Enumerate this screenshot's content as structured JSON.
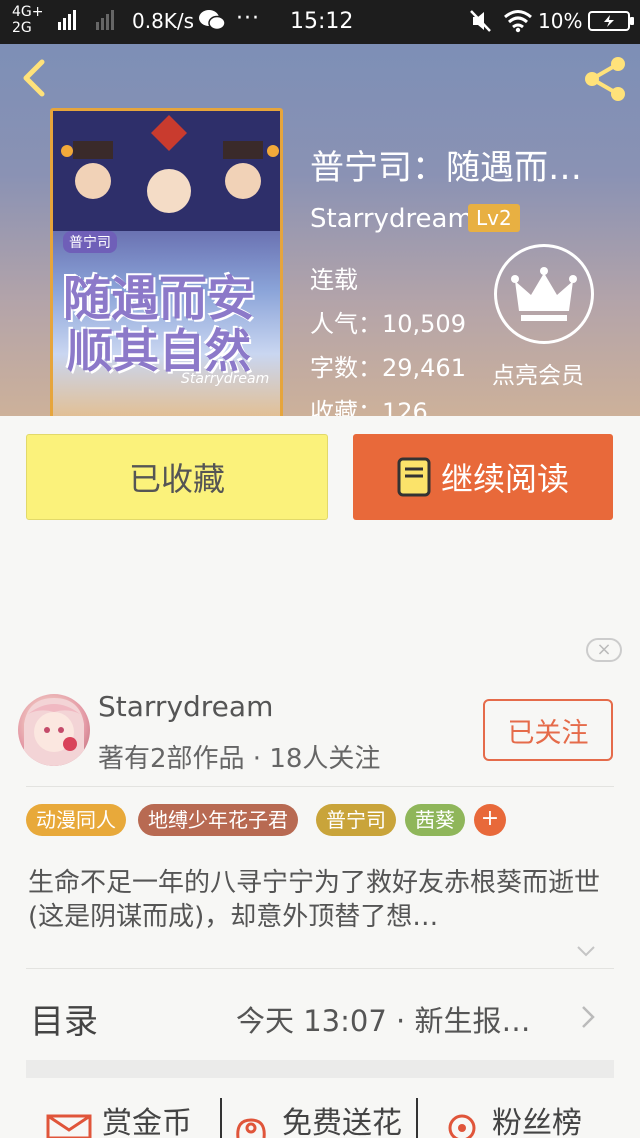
{
  "status_bar": {
    "network_top": "4G+",
    "network_bottom": "2G",
    "speed": "0.8K/s",
    "dots": "···",
    "time": "15:12",
    "battery": "10%"
  },
  "header": {
    "back_icon": "chevron-left-icon",
    "share_icon": "share-icon"
  },
  "cover": {
    "tag": "普宁司",
    "line1": "随遇而安",
    "line2": "顺其自然",
    "signature": "Starrydream"
  },
  "book": {
    "title": "普宁司：随遇而…",
    "author": "Starrydream",
    "level": "Lv2",
    "status": "连载",
    "popularity": "人气：10,509",
    "word_count": "字数：29,461",
    "collected": "收藏：126",
    "member_label": "点亮会员"
  },
  "actions": {
    "favorited_label": "已收藏",
    "continue_label": "继续阅读"
  },
  "author_card": {
    "name": "Starrydream",
    "meta": "著有2部作品 · 18人关注",
    "follow_label": "已关注"
  },
  "tags": [
    {
      "label": "动漫同人",
      "color": "#e8a93a"
    },
    {
      "label": "地缚少年花子君",
      "color": "#b86a52"
    },
    {
      "label": "普宁司",
      "color": "#c9a43a"
    },
    {
      "label": "茜葵",
      "color": "#8fb65a"
    }
  ],
  "tag_plus": "+",
  "synopsis": "生命不足一年的八寻宁宁为了救好友赤根葵而逝世(这是阴谋而成)，却意外顶替了想…",
  "toc": {
    "label": "目录",
    "latest": "今天 13:07 · 新生报…"
  },
  "bottom": {
    "reward": "赏金币",
    "flower": "免费送花",
    "fans": "粉丝榜"
  },
  "colors": {
    "accent_orange": "#e8693a",
    "favorite_yellow": "#fbf27b",
    "level_badge": "#e8b042"
  }
}
